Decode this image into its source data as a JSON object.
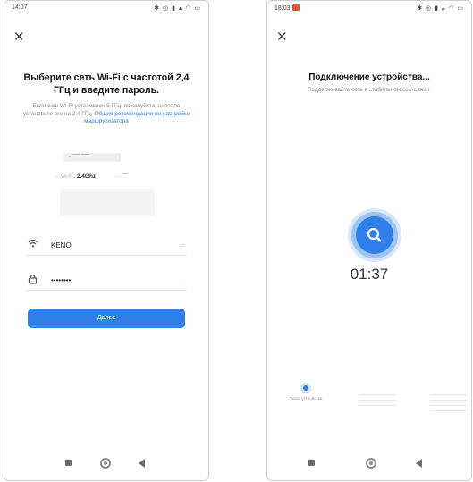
{
  "left_screen": {
    "status_time": "14:07",
    "status_icons": "✱ ◎ ▮ ▴ ◠ ▭",
    "title": "Выберите сеть Wi-Fi с частотой 2,4 ГГц и введите пароль.",
    "subtitle": "Если ваш Wi-Fi установлен 5 ГГц, пожалуйста, сначала установите его на 2,4 ГГц.",
    "subtitle_link": "Общие рекомендации по настройке маршрутизатора",
    "router_band_label": "Wi-Fi",
    "router_band": "2.4Ghz",
    "wifi_value": "KENO",
    "password_value": "••••••••",
    "next_button": "Далее"
  },
  "right_screen": {
    "status_time": "18:03",
    "status_icons": "✱ ◎ ▮ ▴ ◠ ▭",
    "title": "Подключение устройства...",
    "subtitle": "Поддерживайте сеть в стабильном состоянии.",
    "timer": "01:37",
    "step1_label": "Поиск устройства"
  },
  "icons": {
    "close": "close-icon",
    "wifi": "wifi-icon",
    "lock": "lock-icon",
    "search": "search-icon",
    "nav_square": "recents-icon",
    "nav_circle": "home-icon",
    "nav_back": "back-icon"
  },
  "colors": {
    "accent": "#2f7eea",
    "record": "#e8533a"
  }
}
